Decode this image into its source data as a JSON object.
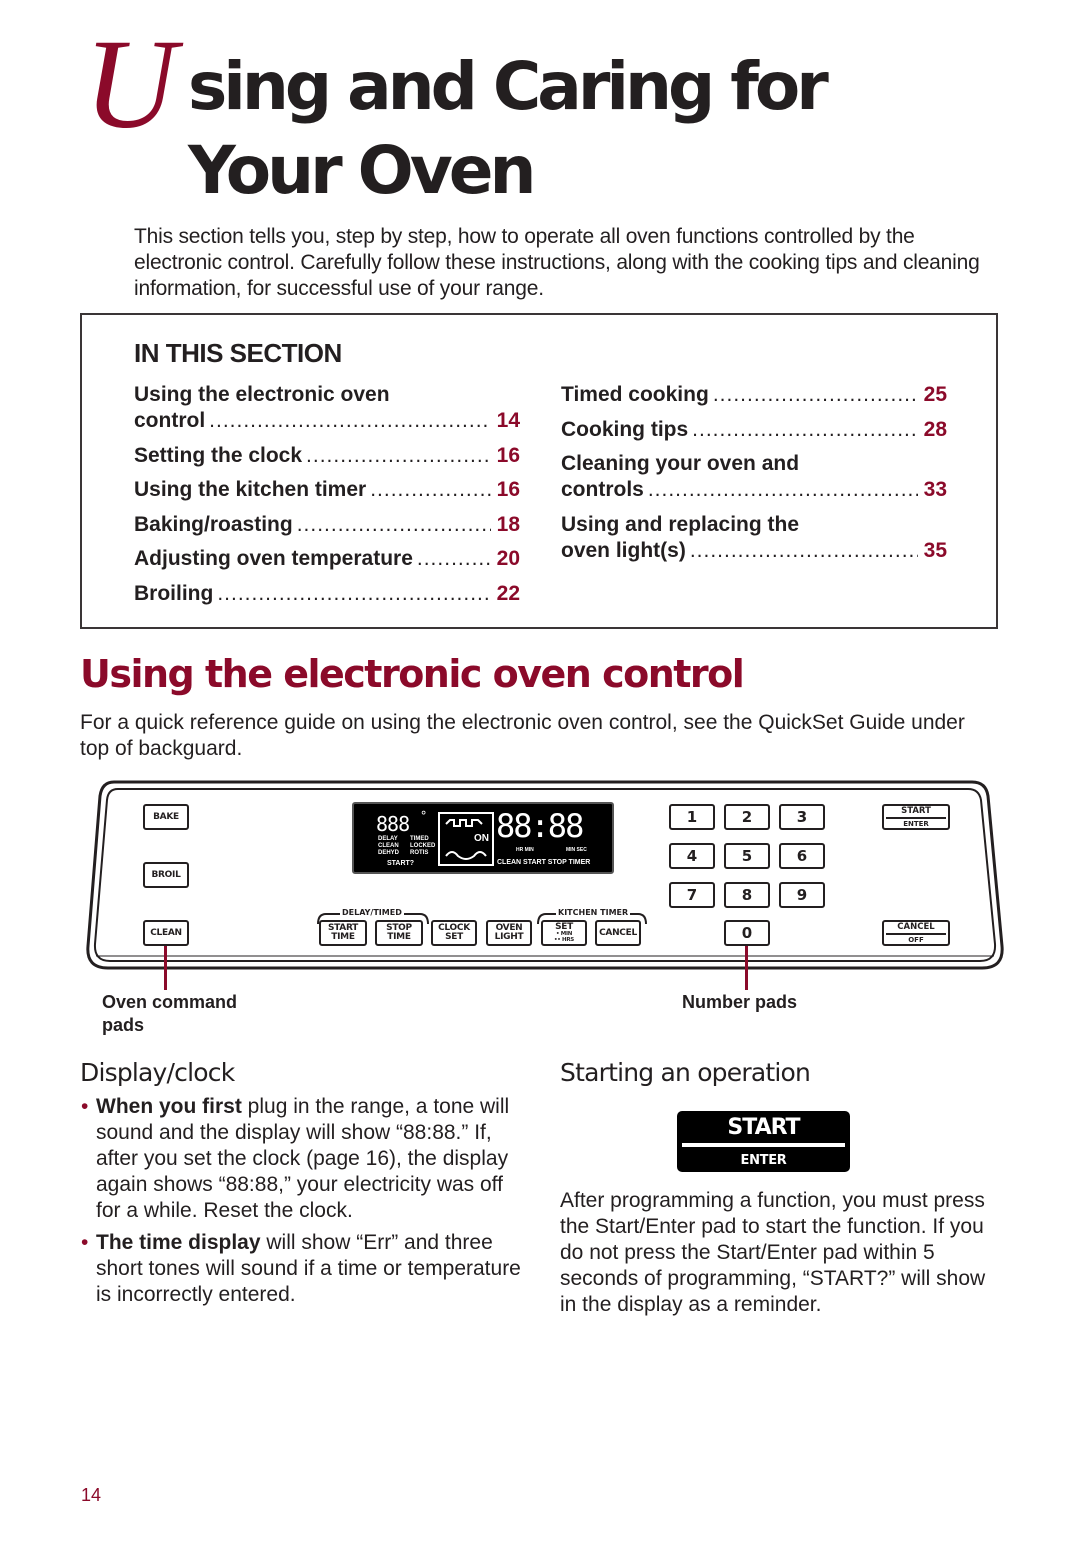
{
  "title": {
    "initial": "U",
    "line1_rest": "sing and Caring for",
    "line2": "Your Oven"
  },
  "intro": "This section tells you, step by step, how to operate all oven functions controlled by the electronic control. Carefully follow these instructions, along with the cooking tips and cleaning information, for successful use of your range.",
  "in_this_section": {
    "heading": "IN THIS SECTION",
    "left_column": [
      {
        "line1": "Using the electronic oven",
        "line2": "control",
        "page": "14"
      },
      {
        "line1": "Setting the clock",
        "page": "16"
      },
      {
        "line1": "Using the kitchen timer",
        "page": "16"
      },
      {
        "line1": "Baking/roasting",
        "page": "18"
      },
      {
        "line1": "Adjusting oven temperature",
        "page": "20"
      },
      {
        "line1": "Broiling",
        "page": "22"
      }
    ],
    "right_column": [
      {
        "line1": "Timed cooking",
        "page": "25"
      },
      {
        "line1": "Cooking tips",
        "page": "28"
      },
      {
        "line1": "Cleaning your oven and",
        "line2": "controls",
        "page": "33"
      },
      {
        "line1": "Using and replacing the",
        "line2": "oven light(s)",
        "page": "35"
      }
    ]
  },
  "section_heading": "Using the electronic oven control",
  "section_intro": "For a quick reference guide on using the electronic oven control, see the QuickSet Guide under top of backguard.",
  "control_panel": {
    "command_pads": [
      "BAKE",
      "BROIL",
      "CLEAN"
    ],
    "display": {
      "temp_digits": "888",
      "degree": "°",
      "time_digits": "88:88",
      "on_label": "ON",
      "left_indicators": [
        "DELAY",
        "TIMED",
        "CLEAN",
        "LOCKED",
        "DEHYD",
        "ROTIS"
      ],
      "start_prompt": "START?",
      "hr_min": "HR MIN",
      "min_sec": "MIN SEC",
      "status_words": "CLEAN START STOP TIMER"
    },
    "group_labels": {
      "delay_timed": "DELAY/TIMED",
      "kitchen_timer": "KITCHEN TIMER"
    },
    "function_pads": [
      {
        "line1": "START",
        "line2": "TIME"
      },
      {
        "line1": "STOP",
        "line2": "TIME"
      },
      {
        "line1": "CLOCK",
        "line2": "SET"
      },
      {
        "line1": "OVEN",
        "line2": "LIGHT"
      },
      {
        "line1": "SET",
        "line2": "• MIN",
        "line3": "•• HRS"
      },
      {
        "line1": "CANCEL"
      }
    ],
    "number_pads": [
      "1",
      "2",
      "3",
      "4",
      "5",
      "6",
      "7",
      "8",
      "9",
      "0"
    ],
    "start_enter": {
      "top": "START",
      "bottom": "ENTER"
    },
    "cancel_off": {
      "top": "CANCEL",
      "bottom": "OFF"
    },
    "callouts": {
      "left": "Oven command pads",
      "right": "Number pads"
    }
  },
  "display_clock": {
    "heading": "Display/clock",
    "bullets": [
      {
        "bold": "When you first",
        "text": " plug in the range, a tone will sound and the display will show “88:88.” If, after you set the clock (page 16), the display again shows “88:88,” your electricity was off for a while. Reset the clock."
      },
      {
        "bold": "The time display",
        "text": " will show “Err” and three short tones will sound if a time or temperature is incorrectly entered."
      }
    ]
  },
  "starting_operation": {
    "heading": "Starting an operation",
    "button": {
      "top": "START",
      "bottom": "ENTER"
    },
    "text": "After programming a function, you must press the Start/Enter pad to start the function. If you do not press the Start/Enter pad within 5 seconds of programming, “START?” will show in the display as a reminder."
  },
  "page_number": "14",
  "colors": {
    "accent": "#8b0a2a",
    "text": "#231f20"
  }
}
